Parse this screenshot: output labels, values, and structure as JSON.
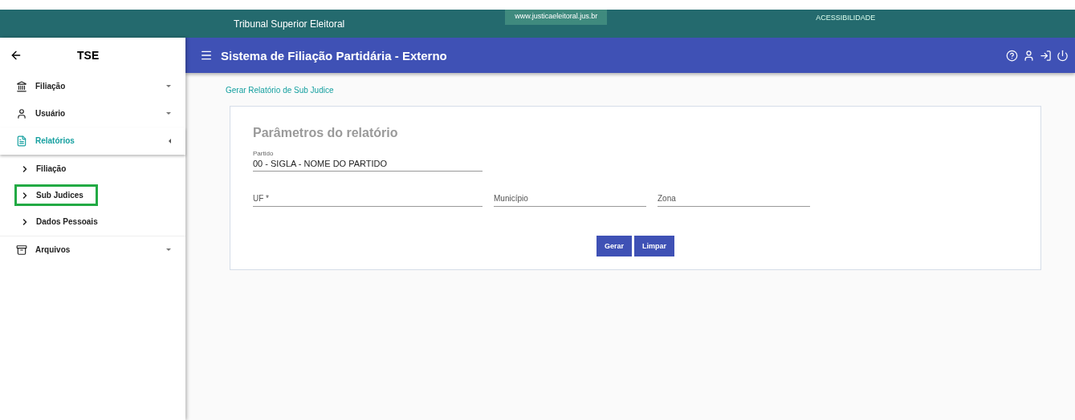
{
  "top_banner": {
    "title": "Tribunal Superior Eleitoral",
    "site": "www.justicaeleitoral.jus.br",
    "accessibility": "ACESSIBILIDADE"
  },
  "sidebar": {
    "title": "TSE",
    "items": [
      {
        "label": "Filiação",
        "expanded": false,
        "active": false
      },
      {
        "label": "Usuário",
        "expanded": false,
        "active": false
      },
      {
        "label": "Relatórios",
        "expanded": true,
        "active": true,
        "children": [
          {
            "label": "Filiação",
            "highlighted": false
          },
          {
            "label": "Sub Judices",
            "highlighted": true
          },
          {
            "label": "Dados Pessoais",
            "highlighted": false
          }
        ]
      },
      {
        "label": "Arquivos",
        "expanded": false,
        "active": false
      }
    ]
  },
  "header": {
    "title": "Sistema de Filiação Partidária - Externo"
  },
  "breadcrumb": "Gerar Relatório de Sub Judice",
  "form": {
    "title": "Parâmetros do relatório",
    "fields": [
      {
        "label": "Partido",
        "value": "00 - SIGLA - NOME DO PARTIDO"
      }
    ],
    "row_fields": [
      {
        "placeholder": "UF *"
      },
      {
        "placeholder": "Município"
      },
      {
        "placeholder": "Zona"
      }
    ],
    "buttons": [
      "Gerar",
      "Limpar"
    ]
  }
}
